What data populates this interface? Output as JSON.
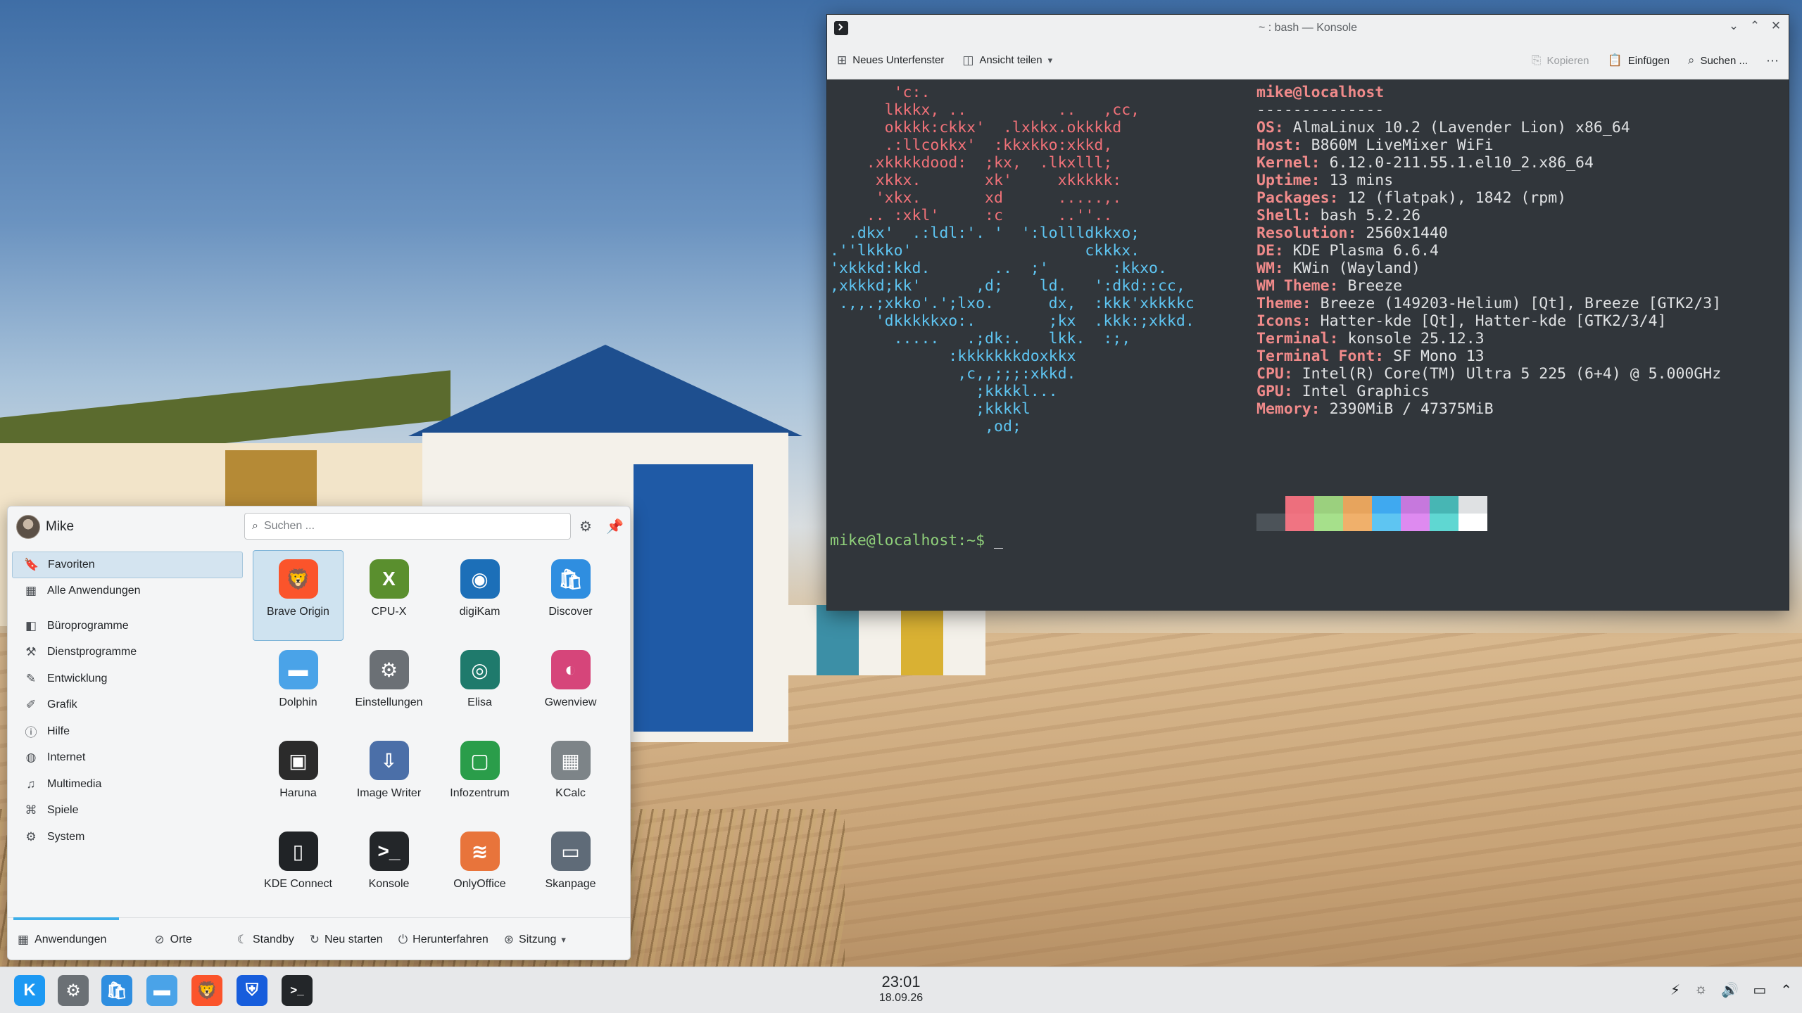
{
  "konsole": {
    "title": "~ : bash — Konsole",
    "toolbar": {
      "new_tab": "Neues Unterfenster",
      "split_view": "Ansicht teilen",
      "copy": "Kopieren",
      "paste": "Einfügen",
      "find": "Suchen ..."
    },
    "ascii_lines": [
      "       'c:.",
      "      lkkkx, ..          ..   ,cc,",
      "      okkkk:ckkx'  .lxkkx.okkkkd",
      "      .:llcokkx'  :kkxkko:xkkd,",
      "    .xkkkkdood:  ;kx,  .lkxlll;",
      "     xkkx.       xk'     xkkkkk:",
      "     'xkx.       xd      .....,.",
      "    .. :xkl'     :c      ..''..",
      "  .dkx'  .:ldl:'. '  ':lollldkkxo;",
      ".''lkkko'                   ckkkx.",
      "'xkkkd:kkd.       ..  ;'       :kkxo.",
      ",xkkkd;kk'      ,d;    ld.   ':dkd::cc,",
      " .,,.;xkko'.';lxo.      dx,  :kkk'xkkkkc",
      "     'dkkkkkxo:.        ;kx  .kkk:;xkkd.",
      "       .....   .;dk:.   lkk.  :;,",
      "             :kkkkkkkdoxkkx",
      "              ,c,,;;;:xkkd.",
      "                ;kkkkl...",
      "                ;kkkkl",
      "                 ,od;"
    ],
    "neofetch": {
      "user": "mike@localhost",
      "separator": "--------------",
      "fields": [
        {
          "key": "OS",
          "value": "AlmaLinux 10.2 (Lavender Lion) x86_64"
        },
        {
          "key": "Host",
          "value": "B860M LiveMixer WiFi"
        },
        {
          "key": "Kernel",
          "value": "6.12.0-211.55.1.el10_2.x86_64"
        },
        {
          "key": "Uptime",
          "value": "13 mins"
        },
        {
          "key": "Packages",
          "value": "12 (flatpak), 1842 (rpm)"
        },
        {
          "key": "Shell",
          "value": "bash 5.2.26"
        },
        {
          "key": "Resolution",
          "value": "2560x1440"
        },
        {
          "key": "DE",
          "value": "KDE Plasma 6.6.4"
        },
        {
          "key": "WM",
          "value": "KWin (Wayland)"
        },
        {
          "key": "WM Theme",
          "value": "Breeze"
        },
        {
          "key": "Theme",
          "value": "Breeze (149203-Helium) [Qt], Breeze [GTK2/3]"
        },
        {
          "key": "Icons",
          "value": "Hatter-kde [Qt], Hatter-kde [GTK2/3/4]"
        },
        {
          "key": "Terminal",
          "value": "konsole 25.12.3"
        },
        {
          "key": "Terminal Font",
          "value": "SF Mono 13"
        },
        {
          "key": "CPU",
          "value": "Intel(R) Core(TM) Ultra 5 225 (6+4) @ 5.000GHz"
        },
        {
          "key": "GPU",
          "value": "Intel Graphics"
        },
        {
          "key": "Memory",
          "value": "2390MiB / 47375MiB"
        }
      ],
      "palette_top": [
        "#31363b",
        "#ed6f7d",
        "#9bd07e",
        "#e7a45d",
        "#3fa9f0",
        "#c678dd",
        "#47b6b4",
        "#dfe1e3"
      ],
      "palette_bottom": [
        "#4c5359",
        "#f07482",
        "#a6e08b",
        "#f0b06b",
        "#5ec5f2",
        "#de8af0",
        "#5fd7d2",
        "#ffffff"
      ]
    },
    "prompt": "mike@localhost:~$ ",
    "cursor": "_"
  },
  "launcher": {
    "username": "Mike",
    "search_placeholder": "Suchen ...",
    "categories": [
      {
        "label": "Favoriten",
        "icon": "bookmark-icon",
        "glyph": "🔖"
      },
      {
        "label": "Alle Anwendungen",
        "icon": "grid-icon",
        "glyph": "▦"
      },
      {
        "label": "Büroprogramme",
        "icon": "office-icon",
        "glyph": "◧"
      },
      {
        "label": "Dienstprogramme",
        "icon": "utilities-icon",
        "glyph": "⚒"
      },
      {
        "label": "Entwicklung",
        "icon": "development-icon",
        "glyph": "✎"
      },
      {
        "label": "Grafik",
        "icon": "graphics-icon",
        "glyph": "✐"
      },
      {
        "label": "Hilfe",
        "icon": "help-icon",
        "glyph": "ⓘ"
      },
      {
        "label": "Internet",
        "icon": "internet-icon",
        "glyph": "◍"
      },
      {
        "label": "Multimedia",
        "icon": "multimedia-icon",
        "glyph": "♫"
      },
      {
        "label": "Spiele",
        "icon": "games-icon",
        "glyph": "⌘"
      },
      {
        "label": "System",
        "icon": "system-icon",
        "glyph": "⚙"
      }
    ],
    "apps": [
      {
        "label": "Brave Origin",
        "icon": "brave-icon",
        "glyph": "🦁",
        "color": "#fb542b"
      },
      {
        "label": "CPU-X",
        "icon": "cpu-x-icon",
        "glyph": "X",
        "color": "#5a8f2e"
      },
      {
        "label": "digiKam",
        "icon": "digikam-icon",
        "glyph": "◉",
        "color": "#1c6fb8"
      },
      {
        "label": "Discover",
        "icon": "discover-icon",
        "glyph": "🛍",
        "color": "#2f8ee0"
      },
      {
        "label": "Dolphin",
        "icon": "dolphin-icon",
        "glyph": "▬",
        "color": "#4aa3e8"
      },
      {
        "label": "Einstellungen",
        "icon": "settings-icon",
        "glyph": "⚙",
        "color": "#6b7075"
      },
      {
        "label": "Elisa",
        "icon": "elisa-icon",
        "glyph": "◎",
        "color": "#1f7a6c"
      },
      {
        "label": "Gwenview",
        "icon": "gwenview-icon",
        "glyph": "◐",
        "color": "#d6457a"
      },
      {
        "label": "Haruna",
        "icon": "haruna-icon",
        "glyph": "▣",
        "color": "#2b2b2b"
      },
      {
        "label": "Image Writer",
        "icon": "image-writer-icon",
        "glyph": "⇩",
        "color": "#4b6fa8"
      },
      {
        "label": "Infozentrum",
        "icon": "infocenter-icon",
        "glyph": "▢",
        "color": "#2a9d4a"
      },
      {
        "label": "KCalc",
        "icon": "kcalc-icon",
        "glyph": "▦",
        "color": "#7d8488"
      },
      {
        "label": "KDE Connect",
        "icon": "kde-connect-icon",
        "glyph": "▯",
        "color": "#202326"
      },
      {
        "label": "Konsole",
        "icon": "konsole-icon",
        "glyph": ">_",
        "color": "#232629"
      },
      {
        "label": "OnlyOffice",
        "icon": "onlyoffice-icon",
        "glyph": "≋",
        "color": "#e8743b"
      },
      {
        "label": "Skanpage",
        "icon": "skanpage-icon",
        "glyph": "▭",
        "color": "#5f6b78"
      }
    ],
    "footer": {
      "applications": "Anwendungen",
      "places": "Orte",
      "standby": "Standby",
      "restart": "Neu starten",
      "shutdown": "Herunterfahren",
      "session": "Sitzung"
    }
  },
  "taskbar": {
    "items": [
      {
        "name": "launcher-button",
        "icon": "kde-logo-icon",
        "glyph": "K",
        "color": "#1d99f3"
      },
      {
        "name": "task-settings",
        "icon": "settings-icon",
        "glyph": "⚙",
        "color": "#6b7075"
      },
      {
        "name": "task-discover",
        "icon": "discover-icon",
        "glyph": "🛍",
        "color": "#2f8ee0"
      },
      {
        "name": "task-dolphin",
        "icon": "dolphin-icon",
        "glyph": "▬",
        "color": "#4aa3e8"
      },
      {
        "name": "task-brave",
        "icon": "brave-icon",
        "glyph": "🦁",
        "color": "#fb542b"
      },
      {
        "name": "task-bitwarden",
        "icon": "bitwarden-icon",
        "glyph": "⛨",
        "color": "#175ddc"
      },
      {
        "name": "task-konsole",
        "icon": "konsole-icon",
        "glyph": ">_",
        "color": "#232629"
      }
    ],
    "time": "23:01",
    "date": "18.09.26",
    "tray": [
      {
        "name": "power-icon",
        "glyph": "⚡"
      },
      {
        "name": "brightness-icon",
        "glyph": "☼"
      },
      {
        "name": "volume-icon",
        "glyph": "🔊"
      },
      {
        "name": "notifications-icon",
        "glyph": "▭"
      },
      {
        "name": "expand-tray-icon",
        "glyph": "⌃"
      }
    ]
  }
}
